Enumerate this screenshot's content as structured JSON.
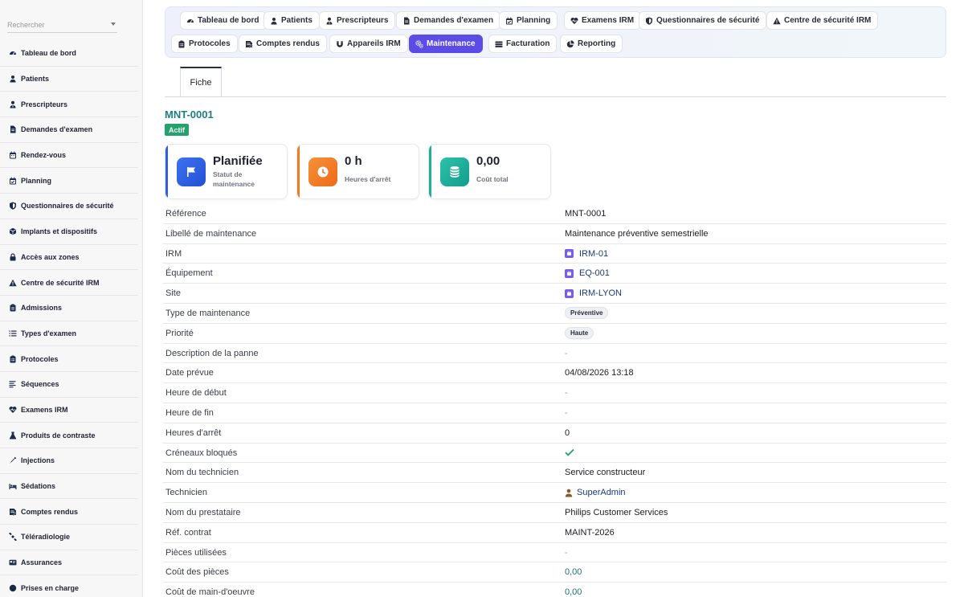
{
  "sidebar": {
    "search_placeholder": "Rechercher",
    "items": [
      {
        "label": "Tableau de bord",
        "icon": "dashboard-icon"
      },
      {
        "label": "Patients",
        "icon": "user-icon"
      },
      {
        "label": "Prescripteurs",
        "icon": "doctor-icon"
      },
      {
        "label": "Demandes d'examen",
        "icon": "file-icon"
      },
      {
        "label": "Rendez-vous",
        "icon": "calendar-icon"
      },
      {
        "label": "Planning",
        "icon": "calendar-check-icon"
      },
      {
        "label": "Questionnaires de sécurité",
        "icon": "shield-icon"
      },
      {
        "label": "Implants et dispositifs",
        "icon": "box-icon"
      },
      {
        "label": "Accès aux zones",
        "icon": "lock-icon"
      },
      {
        "label": "Centre de sécurité IRM",
        "icon": "warning-icon"
      },
      {
        "label": "Admissions",
        "icon": "clipboard-icon"
      },
      {
        "label": "Types d'examen",
        "icon": "list-icon"
      },
      {
        "label": "Protocoles",
        "icon": "clipboard-list-icon"
      },
      {
        "label": "Séquences",
        "icon": "lines-icon"
      },
      {
        "label": "Examens IRM",
        "icon": "heartbeat-icon"
      },
      {
        "label": "Produits de contraste",
        "icon": "flask-icon"
      },
      {
        "label": "Injections",
        "icon": "syringe-icon"
      },
      {
        "label": "Sédations",
        "icon": "bed-icon"
      },
      {
        "label": "Comptes rendus",
        "icon": "report-icon"
      },
      {
        "label": "Téléradiologie",
        "icon": "satellite-icon"
      },
      {
        "label": "Assurances",
        "icon": "card-icon"
      },
      {
        "label": "Prises en charge",
        "icon": "circle-icon"
      }
    ]
  },
  "topnav": {
    "row1": [
      {
        "label": "Tableau de bord",
        "icon": "dashboard-icon"
      },
      {
        "label": "Patients",
        "icon": "user-icon"
      },
      {
        "label": "Prescripteurs",
        "icon": "doctor-icon"
      },
      {
        "label": "Demandes d'examen",
        "icon": "file-icon"
      },
      {
        "label": "Planning",
        "icon": "calendar-check-icon"
      },
      {
        "label": "Examens IRM",
        "icon": "heartbeat-icon"
      },
      {
        "label": "Questionnaires de sécurité",
        "icon": "shield-icon"
      },
      {
        "label": "Centre de sécurité IRM",
        "icon": "warning-icon"
      }
    ],
    "row2": [
      {
        "label": "Protocoles",
        "icon": "clipboard-list-icon"
      },
      {
        "label": "Comptes rendus",
        "icon": "report-icon"
      },
      {
        "label": "Appareils IRM",
        "icon": "magnet-icon"
      },
      {
        "label": "Maintenance",
        "icon": "cogs-icon",
        "active": true
      },
      {
        "label": "Facturation",
        "icon": "money-icon"
      },
      {
        "label": "Reporting",
        "icon": "chart-pie-icon"
      }
    ]
  },
  "view_tab": "Fiche",
  "record": {
    "title": "MNT-0001",
    "status_badge": "Actif"
  },
  "stats": [
    {
      "value": "Planifiée",
      "label": "Statut de maintenance",
      "color": "#2f5fe0",
      "icon": "flag-icon"
    },
    {
      "value": "0 h",
      "label": "Heures d'arrêt",
      "color": "#f07c22",
      "icon": "clock-icon"
    },
    {
      "value": "0,00",
      "label": "Coût total",
      "color": "#1fae9c",
      "icon": "coins-icon"
    }
  ],
  "details": [
    {
      "label": "Référence",
      "value": "MNT-0001",
      "kind": "text"
    },
    {
      "label": "Libellé de maintenance",
      "value": "Maintenance préventive semestrielle",
      "kind": "text"
    },
    {
      "label": "IRM",
      "value": "IRM-01",
      "kind": "link"
    },
    {
      "label": "Équipement",
      "value": "EQ-001",
      "kind": "link"
    },
    {
      "label": "Site",
      "value": "IRM-LYON",
      "kind": "link"
    },
    {
      "label": "Type de maintenance",
      "value": "Préventive",
      "kind": "tag"
    },
    {
      "label": "Priorité",
      "value": "Haute",
      "kind": "tag"
    },
    {
      "label": "Description de la panne",
      "value": "-",
      "kind": "dash"
    },
    {
      "label": "Date prévue",
      "value": "04/08/2026 13:18",
      "kind": "text"
    },
    {
      "label": "Heure de début",
      "value": "-",
      "kind": "dash"
    },
    {
      "label": "Heure de fin",
      "value": "-",
      "kind": "dash"
    },
    {
      "label": "Heures d'arrêt",
      "value": "0",
      "kind": "text"
    },
    {
      "label": "Créneaux bloqués",
      "value": "",
      "kind": "check"
    },
    {
      "label": "Nom du technicien",
      "value": "Service constructeur",
      "kind": "text"
    },
    {
      "label": "Technicien",
      "value": "SuperAdmin",
      "kind": "user"
    },
    {
      "label": "Nom du prestataire",
      "value": "Philips Customer Services",
      "kind": "text"
    },
    {
      "label": "Réf. contrat",
      "value": "MAINT-2026",
      "kind": "text"
    },
    {
      "label": "Pièces utilisées",
      "value": "-",
      "kind": "dash"
    },
    {
      "label": "Coût des pièces",
      "value": "0,00",
      "kind": "money"
    },
    {
      "label": "Coût de main-d'oeuvre",
      "value": "0,00",
      "kind": "money"
    }
  ],
  "colors": {
    "accent": "#5b4ce8",
    "title": "#1d7d87",
    "badge": "#23a36b",
    "check": "#23a36b"
  }
}
